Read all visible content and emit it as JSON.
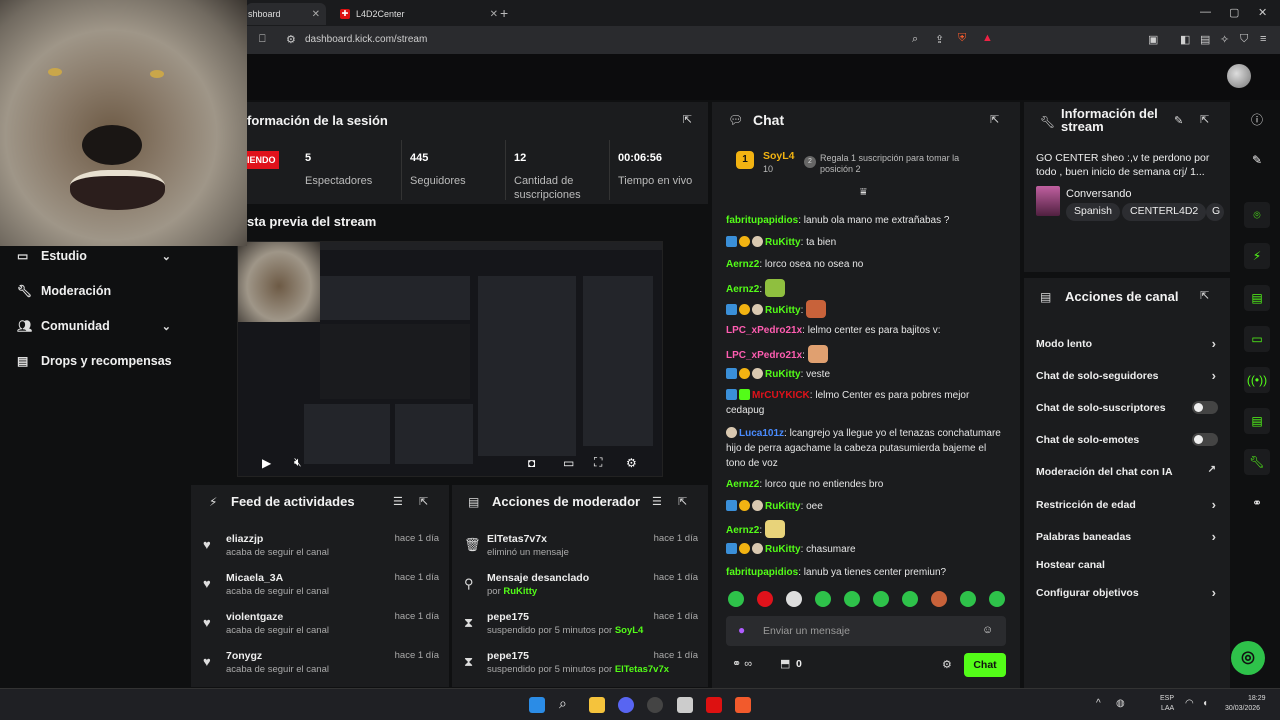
{
  "browser": {
    "tabs": [
      {
        "label": "shboard"
      },
      {
        "label": "L4D2Center"
      }
    ],
    "url": "dashboard.kick.com/stream"
  },
  "sidebar": {
    "items": [
      {
        "label": "Estudio",
        "icon": "studio-icon",
        "expandable": true
      },
      {
        "label": "Moderación",
        "icon": "wrench-icon",
        "expandable": false
      },
      {
        "label": "Comunidad",
        "icon": "people-icon",
        "expandable": true
      },
      {
        "label": "Drops y recompensas",
        "icon": "gift-icon",
        "expandable": false
      }
    ]
  },
  "session": {
    "title": "formación de la sesión",
    "live_label": "IENDO",
    "stats": [
      {
        "value": "5",
        "label": "Espectadores"
      },
      {
        "value": "445",
        "label": "Seguidores"
      },
      {
        "value": "12",
        "label": "Cantidad de suscripciones"
      },
      {
        "value": "00:06:56",
        "label": "Tiempo en vivo"
      }
    ]
  },
  "preview": {
    "title": "sta previa del stream"
  },
  "feed": {
    "title": "Feed de actividades",
    "items": [
      {
        "name": "eliazzjp",
        "sub": "acaba de seguir el canal",
        "time": "hace 1 día"
      },
      {
        "name": "Micaela_3A",
        "sub": "acaba de seguir el canal",
        "time": "hace 1 día"
      },
      {
        "name": "violentgaze",
        "sub": "acaba de seguir el canal",
        "time": "hace 1 día"
      },
      {
        "name": "7onygz",
        "sub": "acaba de seguir el canal",
        "time": "hace 1 día"
      }
    ]
  },
  "mod_actions": {
    "title": "Acciones de moderador",
    "items": [
      {
        "name": "ElTetas7v7x",
        "sub": "eliminó un mensaje",
        "by": "",
        "time": "hace 1 día",
        "icon": "trash-icon"
      },
      {
        "name": "Mensaje desanclado",
        "sub": "por ",
        "by": "RuKitty",
        "time": "hace 1 día",
        "icon": "unpin-icon"
      },
      {
        "name": "pepe175",
        "sub": "suspendido por 5 minutos por ",
        "by": "SoyL4",
        "time": "hace 1 día",
        "icon": "hourglass-icon"
      },
      {
        "name": "pepe175",
        "sub": "suspendido por 5 minutos por ",
        "by": "ElTetas7v7x",
        "time": "hace 1 día",
        "icon": "hourglass-icon"
      }
    ]
  },
  "chat": {
    "title": "Chat",
    "goal_user": "SoyL4",
    "goal_rank": "1",
    "goal_count": "10",
    "goal_text": "Regala 1 suscripción para tomar la posición 2",
    "goal_badge": "2",
    "messages": [
      {
        "user": "fabritupapidios",
        "color": "#53fc18",
        "badges": [],
        "text": "lanub ola mano me extrañabas ?"
      },
      {
        "user": "RuKitty",
        "color": "#53fc18",
        "badges": [
          "blue",
          "gold",
          "cat"
        ],
        "text": "ta bien"
      },
      {
        "user": "Aernz2",
        "color": "#53fc18",
        "badges": [],
        "text": "lorco osea no osea no"
      },
      {
        "user": "Aernz2",
        "color": "#53fc18",
        "badges": [],
        "text": "",
        "emote": "#8fbf3f"
      },
      {
        "user": "RuKitty",
        "color": "#53fc18",
        "badges": [
          "blue",
          "gold",
          "cat"
        ],
        "text": "",
        "emote": "#c8623a"
      },
      {
        "user": "LPC_xPedro21x",
        "color": "#ff5db1",
        "badges": [],
        "text": "lelmo center es para bajitos v:"
      },
      {
        "user": "LPC_xPedro21x",
        "color": "#ff5db1",
        "badges": [],
        "text": "",
        "emote": "#e0a070"
      },
      {
        "user": "RuKitty",
        "color": "#53fc18",
        "badges": [
          "blue",
          "gold",
          "cat"
        ],
        "text": "veste"
      },
      {
        "user": "MrCUYKICK",
        "color": "#e0121b",
        "badges": [
          "blue",
          "green"
        ],
        "text": "lelmo Center es para pobres mejor cedapug"
      },
      {
        "user": "Luca101z",
        "color": "#4a8cff",
        "badges": [
          "cat"
        ],
        "text": "lcangrejo ya llegue yo el tenazas conchatumare hijo de perra agachame la cabeza putasumierda bajeme el tono de voz"
      },
      {
        "user": "Aernz2",
        "color": "#53fc18",
        "badges": [],
        "text": "lorco que no entiendes bro"
      },
      {
        "user": "RuKitty",
        "color": "#53fc18",
        "badges": [
          "blue",
          "gold",
          "cat"
        ],
        "text": "oee"
      },
      {
        "user": "Aernz2",
        "color": "#53fc18",
        "badges": [],
        "text": "",
        "emote": "#e8d37a"
      },
      {
        "user": "RuKitty",
        "color": "#53fc18",
        "badges": [
          "blue",
          "gold",
          "cat"
        ],
        "text": "chasumare"
      },
      {
        "user": "fabritupapidios",
        "color": "#53fc18",
        "badges": [],
        "text": "lanub ya tienes center premiun?"
      }
    ],
    "input_placeholder": "Enviar un mensaje",
    "points": "0",
    "send_label": "Chat"
  },
  "stream_info": {
    "title": "Información del stream",
    "stream_title": "GO CENTER sheo :,v te perdono por todo , buen inicio de semana crj/ 1...",
    "category": "Conversando",
    "tags": [
      "Spanish",
      "CENTERL4D2",
      "G"
    ]
  },
  "channel_actions": {
    "title": "Acciones de canal",
    "items": [
      {
        "label": "Modo lento",
        "control": "arrow"
      },
      {
        "label": "Chat de solo-seguidores",
        "control": "arrow"
      },
      {
        "label": "Chat de solo-suscriptores",
        "control": "toggle"
      },
      {
        "label": "Chat de solo-emotes",
        "control": "toggle"
      },
      {
        "label": "Moderación del chat con IA",
        "control": "external"
      },
      {
        "label": "Restricción de edad",
        "control": "arrow"
      },
      {
        "label": "Palabras baneadas",
        "control": "arrow"
      },
      {
        "label": "Hostear canal",
        "control": "none"
      },
      {
        "label": "Configurar objetivos",
        "control": "arrow"
      }
    ]
  },
  "taskbar": {
    "lang": "ESP",
    "lang2": "LAA",
    "time": "18:29",
    "date": "30/03/2026"
  }
}
